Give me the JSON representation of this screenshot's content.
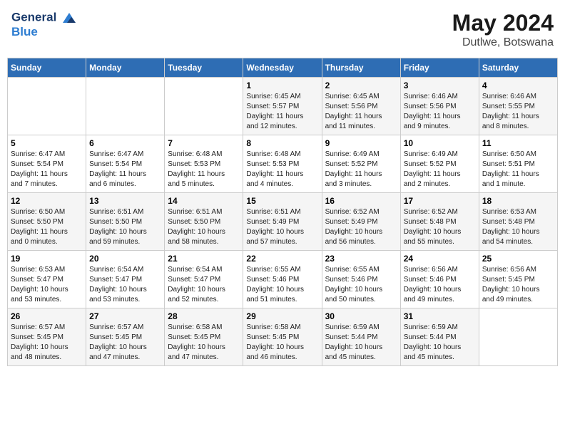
{
  "header": {
    "logo_line1": "General",
    "logo_line2": "Blue",
    "month_year": "May 2024",
    "location": "Dutlwe, Botswana"
  },
  "days_of_week": [
    "Sunday",
    "Monday",
    "Tuesday",
    "Wednesday",
    "Thursday",
    "Friday",
    "Saturday"
  ],
  "weeks": [
    [
      {
        "day": "",
        "info": ""
      },
      {
        "day": "",
        "info": ""
      },
      {
        "day": "",
        "info": ""
      },
      {
        "day": "1",
        "info": "Sunrise: 6:45 AM\nSunset: 5:57 PM\nDaylight: 11 hours\nand 12 minutes."
      },
      {
        "day": "2",
        "info": "Sunrise: 6:45 AM\nSunset: 5:56 PM\nDaylight: 11 hours\nand 11 minutes."
      },
      {
        "day": "3",
        "info": "Sunrise: 6:46 AM\nSunset: 5:56 PM\nDaylight: 11 hours\nand 9 minutes."
      },
      {
        "day": "4",
        "info": "Sunrise: 6:46 AM\nSunset: 5:55 PM\nDaylight: 11 hours\nand 8 minutes."
      }
    ],
    [
      {
        "day": "5",
        "info": "Sunrise: 6:47 AM\nSunset: 5:54 PM\nDaylight: 11 hours\nand 7 minutes."
      },
      {
        "day": "6",
        "info": "Sunrise: 6:47 AM\nSunset: 5:54 PM\nDaylight: 11 hours\nand 6 minutes."
      },
      {
        "day": "7",
        "info": "Sunrise: 6:48 AM\nSunset: 5:53 PM\nDaylight: 11 hours\nand 5 minutes."
      },
      {
        "day": "8",
        "info": "Sunrise: 6:48 AM\nSunset: 5:53 PM\nDaylight: 11 hours\nand 4 minutes."
      },
      {
        "day": "9",
        "info": "Sunrise: 6:49 AM\nSunset: 5:52 PM\nDaylight: 11 hours\nand 3 minutes."
      },
      {
        "day": "10",
        "info": "Sunrise: 6:49 AM\nSunset: 5:52 PM\nDaylight: 11 hours\nand 2 minutes."
      },
      {
        "day": "11",
        "info": "Sunrise: 6:50 AM\nSunset: 5:51 PM\nDaylight: 11 hours\nand 1 minute."
      }
    ],
    [
      {
        "day": "12",
        "info": "Sunrise: 6:50 AM\nSunset: 5:50 PM\nDaylight: 11 hours\nand 0 minutes."
      },
      {
        "day": "13",
        "info": "Sunrise: 6:51 AM\nSunset: 5:50 PM\nDaylight: 10 hours\nand 59 minutes."
      },
      {
        "day": "14",
        "info": "Sunrise: 6:51 AM\nSunset: 5:50 PM\nDaylight: 10 hours\nand 58 minutes."
      },
      {
        "day": "15",
        "info": "Sunrise: 6:51 AM\nSunset: 5:49 PM\nDaylight: 10 hours\nand 57 minutes."
      },
      {
        "day": "16",
        "info": "Sunrise: 6:52 AM\nSunset: 5:49 PM\nDaylight: 10 hours\nand 56 minutes."
      },
      {
        "day": "17",
        "info": "Sunrise: 6:52 AM\nSunset: 5:48 PM\nDaylight: 10 hours\nand 55 minutes."
      },
      {
        "day": "18",
        "info": "Sunrise: 6:53 AM\nSunset: 5:48 PM\nDaylight: 10 hours\nand 54 minutes."
      }
    ],
    [
      {
        "day": "19",
        "info": "Sunrise: 6:53 AM\nSunset: 5:47 PM\nDaylight: 10 hours\nand 53 minutes."
      },
      {
        "day": "20",
        "info": "Sunrise: 6:54 AM\nSunset: 5:47 PM\nDaylight: 10 hours\nand 53 minutes."
      },
      {
        "day": "21",
        "info": "Sunrise: 6:54 AM\nSunset: 5:47 PM\nDaylight: 10 hours\nand 52 minutes."
      },
      {
        "day": "22",
        "info": "Sunrise: 6:55 AM\nSunset: 5:46 PM\nDaylight: 10 hours\nand 51 minutes."
      },
      {
        "day": "23",
        "info": "Sunrise: 6:55 AM\nSunset: 5:46 PM\nDaylight: 10 hours\nand 50 minutes."
      },
      {
        "day": "24",
        "info": "Sunrise: 6:56 AM\nSunset: 5:46 PM\nDaylight: 10 hours\nand 49 minutes."
      },
      {
        "day": "25",
        "info": "Sunrise: 6:56 AM\nSunset: 5:45 PM\nDaylight: 10 hours\nand 49 minutes."
      }
    ],
    [
      {
        "day": "26",
        "info": "Sunrise: 6:57 AM\nSunset: 5:45 PM\nDaylight: 10 hours\nand 48 minutes."
      },
      {
        "day": "27",
        "info": "Sunrise: 6:57 AM\nSunset: 5:45 PM\nDaylight: 10 hours\nand 47 minutes."
      },
      {
        "day": "28",
        "info": "Sunrise: 6:58 AM\nSunset: 5:45 PM\nDaylight: 10 hours\nand 47 minutes."
      },
      {
        "day": "29",
        "info": "Sunrise: 6:58 AM\nSunset: 5:45 PM\nDaylight: 10 hours\nand 46 minutes."
      },
      {
        "day": "30",
        "info": "Sunrise: 6:59 AM\nSunset: 5:44 PM\nDaylight: 10 hours\nand 45 minutes."
      },
      {
        "day": "31",
        "info": "Sunrise: 6:59 AM\nSunset: 5:44 PM\nDaylight: 10 hours\nand 45 minutes."
      },
      {
        "day": "",
        "info": ""
      }
    ]
  ]
}
